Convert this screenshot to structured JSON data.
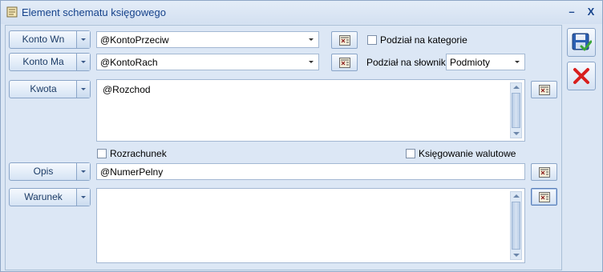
{
  "window": {
    "title": "Element schematu księgowego",
    "minimize_glyph": "–",
    "close_glyph": "X"
  },
  "form": {
    "konto_wn": {
      "label": "Konto Wn",
      "value": "@KontoPrzeciw"
    },
    "konto_ma": {
      "label": "Konto Ma",
      "value": "@KontoRach"
    },
    "kwota": {
      "label": "Kwota",
      "value": "@Rozchod"
    },
    "opis": {
      "label": "Opis",
      "value": "@NumerPelny"
    },
    "warunek": {
      "label": "Warunek",
      "value": ""
    },
    "podzial_kategorie": {
      "label": "Podział na kategorie",
      "checked": false
    },
    "podzial_slowniki": {
      "label": "Podział na słowniki:",
      "value": "Podmioty"
    },
    "rozrachunek": {
      "label": "Rozrachunek",
      "checked": false
    },
    "ksiegowanie_walutowe": {
      "label": "Księgowanie walutowe",
      "checked": false
    }
  },
  "icons": {
    "editor_button": "formula-editor-icon",
    "save": "save-icon",
    "cancel": "cancel-icon",
    "dropdown": "chevron-down-icon"
  },
  "colors": {
    "title_text": "#15428b",
    "cancel_red": "#d81e1e",
    "save_blue": "#2b5fb3",
    "save_check": "#3aa63a"
  }
}
